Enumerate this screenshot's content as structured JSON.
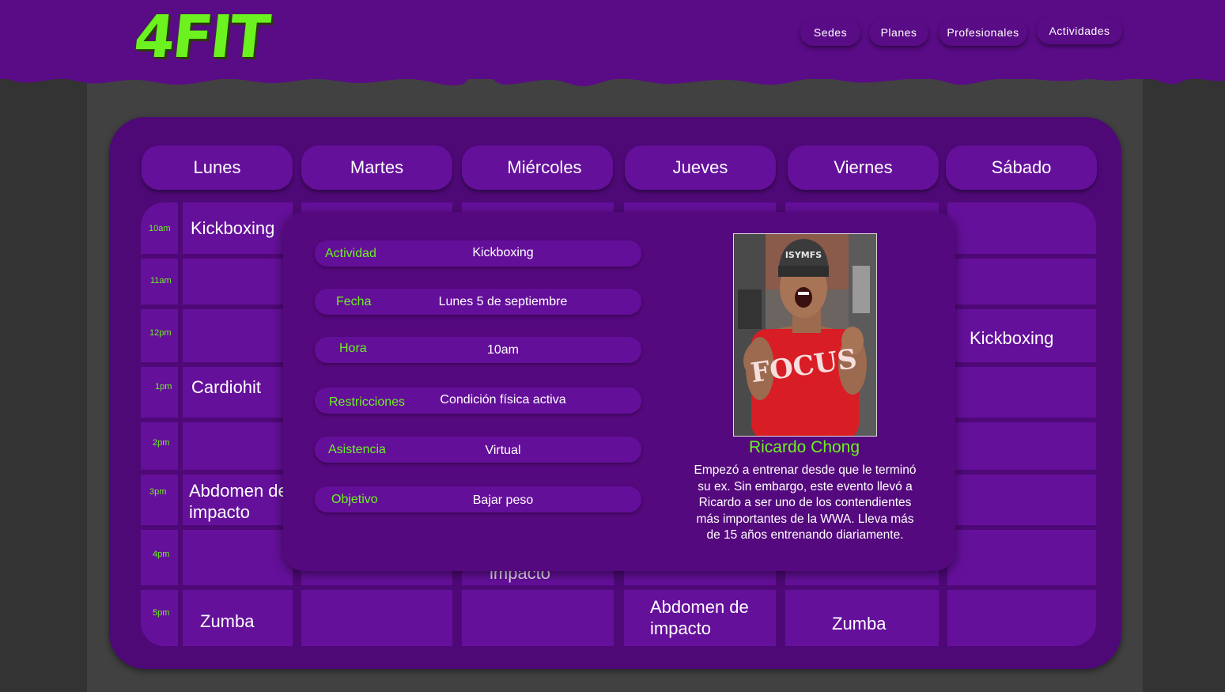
{
  "brand": {
    "logo_text": "4FIT"
  },
  "nav": [
    {
      "label": "Sedes"
    },
    {
      "label": "Planes"
    },
    {
      "label": "Profesionales"
    },
    {
      "label": "Actividades"
    }
  ],
  "schedule": {
    "days": [
      "Lunes",
      "Martes",
      "Miércoles",
      "Jueves",
      "Viernes",
      "Sábado"
    ],
    "times": [
      "10am",
      "11am",
      "12pm",
      "1pm",
      "2pm",
      "3pm",
      "4pm",
      "5pm"
    ],
    "visible_entries": {
      "mon_10am": "Kickboxing",
      "mon_1pm": "Cardiohit",
      "mon_3pm": "Abdomen de impacto",
      "mon_5pm": "Zumba",
      "sat_12pm": "Kickboxing",
      "wed_4pm_partial": "impacto",
      "thu_5pm": "Abdomen de impacto",
      "fri_5pm": "Zumba"
    }
  },
  "detail": {
    "fields": [
      {
        "label": "Actividad",
        "value": "Kickboxing"
      },
      {
        "label": "Fecha",
        "value": "Lunes 5 de septiembre"
      },
      {
        "label": "Hora",
        "value": "10am"
      },
      {
        "label": "Restricciones",
        "value": "Condición física activa"
      },
      {
        "label": "Asistencia",
        "value": "Virtual"
      },
      {
        "label": "Objetivo",
        "value": "Bajar peso"
      }
    ],
    "coach": {
      "name": "Ricardo Chong",
      "bio": "Empezó a entrenar desde que le terminó su ex. Sin embargo, este evento llevó a Ricardo a ser uno de los contendientes más importantes de la WWA. Lleva más de 15 años entrenando diariamente.",
      "photo_shirt_text": "FOCUS",
      "photo_cap_text": "ISYMFS"
    }
  },
  "colors": {
    "brand_purple": "#5a0c87",
    "panel_purple": "#4e0977",
    "cell_purple": "#65109b",
    "accent_green": "#6bf21f"
  }
}
